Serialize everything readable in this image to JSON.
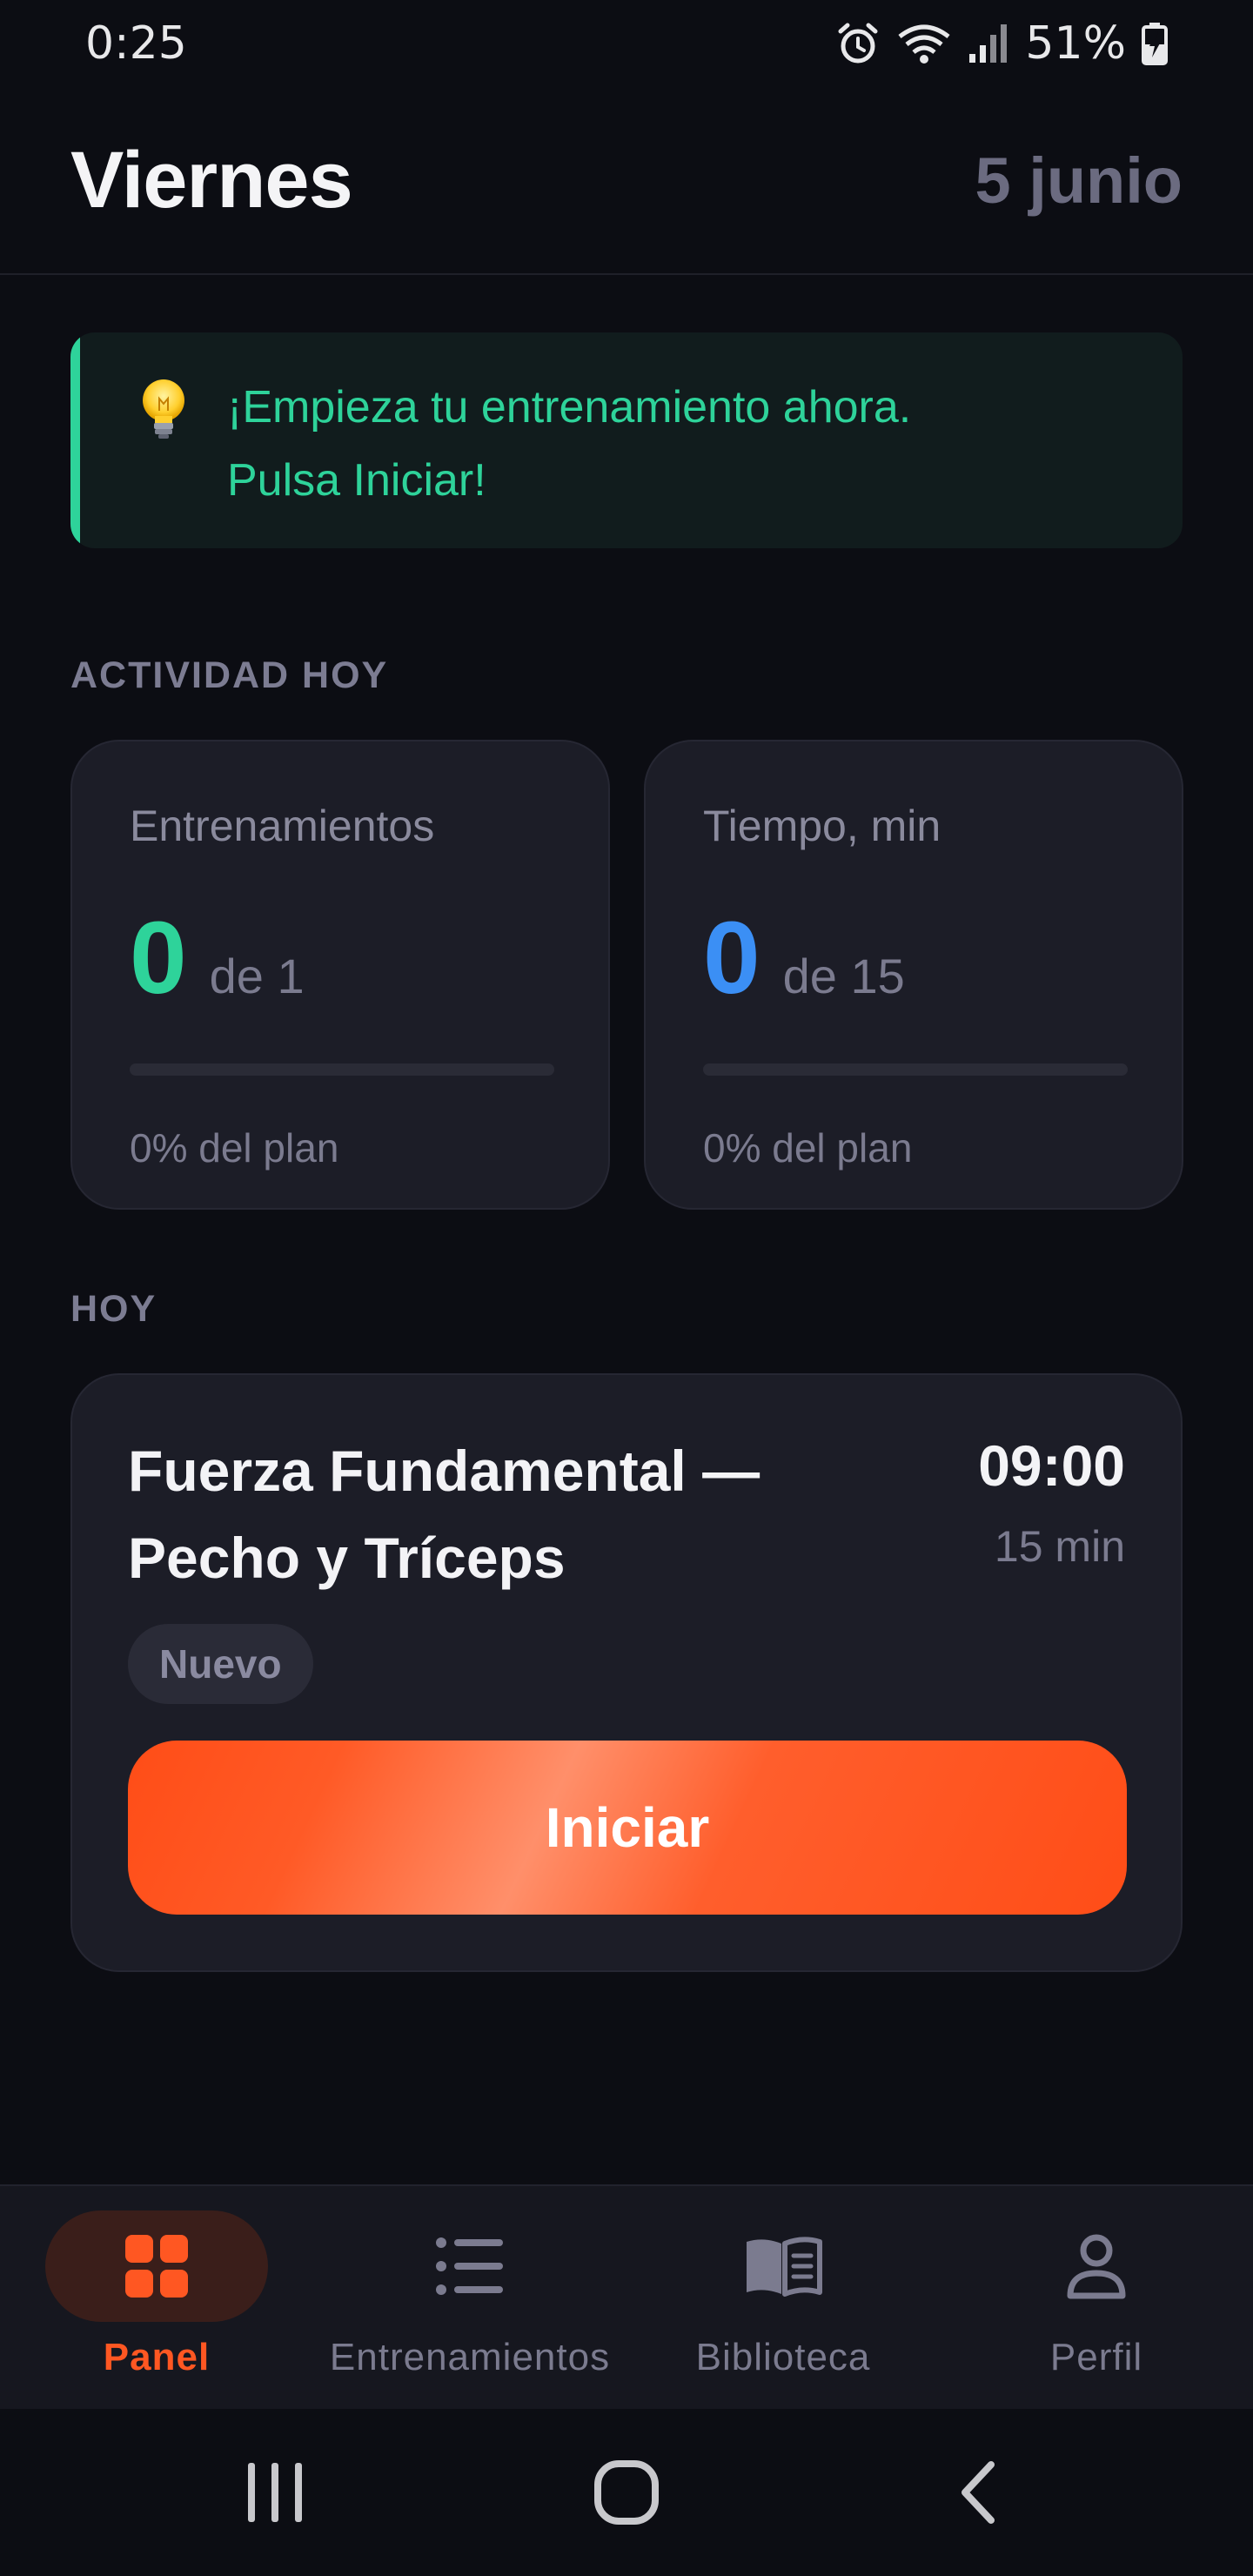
{
  "status_bar": {
    "time": "0:25",
    "battery": "51%",
    "icons": [
      "alarm-icon",
      "wifi-icon",
      "signal-icon",
      "battery-charging-icon"
    ]
  },
  "header": {
    "day": "Viernes",
    "date": "5 junio"
  },
  "tip": {
    "icon": "lightbulb-icon",
    "line1": "¡Empieza tu entrenamiento ahora.",
    "line2": "Pulsa Iniciar!",
    "accent_color": "#2ed39a"
  },
  "activity": {
    "label": "ACTIVIDAD HOY",
    "cards": [
      {
        "title": "Entrenamientos",
        "value": "0",
        "of": "de 1",
        "progress_percent": 0,
        "footer": "0% del plan",
        "color": "#2ed39a"
      },
      {
        "title": "Tiempo, min",
        "value": "0",
        "of": "de 15",
        "progress_percent": 0,
        "footer": "0% del plan",
        "color": "#3b8ff5"
      }
    ]
  },
  "today": {
    "label": "HOY",
    "workout": {
      "name_line1": "Fuerza Fundamental —",
      "name_line2": "Pecho y Tríceps",
      "time": "09:00",
      "duration": "15 min",
      "badge": "Nuevo",
      "start_label": "Iniciar"
    }
  },
  "bottom_nav": {
    "active": "Panel",
    "accent_color": "#ff5722",
    "items": [
      {
        "label": "Panel",
        "icon": "dashboard-grid-icon"
      },
      {
        "label": "Entrenamientos",
        "icon": "list-icon"
      },
      {
        "label": "Biblioteca",
        "icon": "book-icon"
      },
      {
        "label": "Perfil",
        "icon": "person-icon"
      }
    ]
  },
  "system_nav": {
    "icons": [
      "recents-icon",
      "home-icon",
      "back-icon"
    ]
  }
}
